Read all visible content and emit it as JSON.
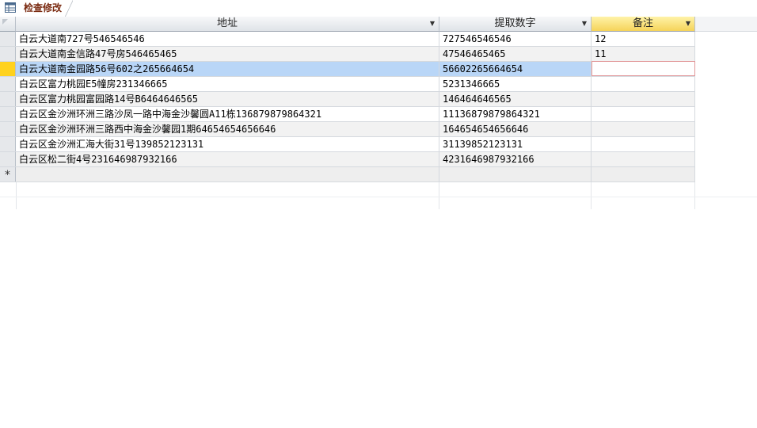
{
  "tab": {
    "label": "检查修改",
    "icon": "table-icon"
  },
  "columns": [
    {
      "label": "地址",
      "sort_icon": "dropdown-arrow-icon"
    },
    {
      "label": "提取数字",
      "sort_icon": "dropdown-arrow-icon"
    },
    {
      "label": "备注",
      "sort_icon": "dropdown-arrow-icon"
    }
  ],
  "rows": [
    {
      "address": "白云大道南727号546546546",
      "digits": "727546546546",
      "note": "12"
    },
    {
      "address": "白云大道南金信路47号房546465465",
      "digits": "47546465465",
      "note": "11"
    },
    {
      "address": "白云大道南金园路56号602之265664654",
      "digits": "56602265664654",
      "note": ""
    },
    {
      "address": "白云区富力桃园E5幢房231346665",
      "digits": "5231346665",
      "note": ""
    },
    {
      "address": "白云区富力桃园富园路14号B6464646565",
      "digits": "146464646565",
      "note": ""
    },
    {
      "address": "白云区金沙洲环洲三路沙凤一路中海金沙馨圆A11栋136879879864321",
      "digits": "11136879879864321",
      "note": ""
    },
    {
      "address": "白云区金沙洲环洲三路西中海金沙馨园1期64654654656646",
      "digits": "164654654656646",
      "note": ""
    },
    {
      "address": "白云区金沙洲汇海大街31号139852123131",
      "digits": "31139852123131",
      "note": ""
    },
    {
      "address": "白云区松二街4号231646987932166",
      "digits": "4231646987932166",
      "note": ""
    }
  ],
  "new_row_marker": "*",
  "colors": {
    "selected_row": "#b9d6f7",
    "selected_indicator": "#ffd21e",
    "active_header": "#f5d35a",
    "focus_border": "#e2989a",
    "tab_text": "#7a2a10"
  }
}
